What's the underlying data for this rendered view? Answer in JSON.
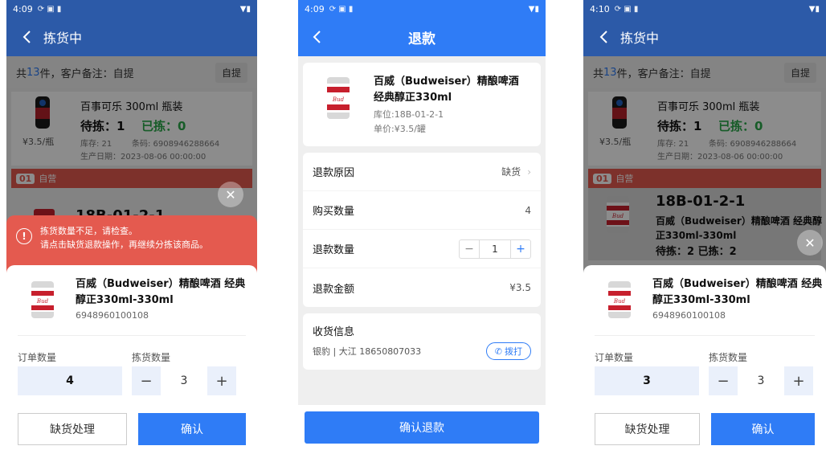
{
  "screens": {
    "picking_left": {
      "status": {
        "time": "4:09",
        "icons": "⟳ ▣ ▮",
        "right": "▼▮"
      },
      "title": "拣货中",
      "summary": {
        "prefix": "共",
        "count": "13",
        "mid": "件，客户备注：自提",
        "tag": "自提"
      },
      "product1": {
        "name": "百事可乐 300ml 瓶装",
        "wait": "待拣：1",
        "done": "已拣：0",
        "price": "¥3.5/瓶",
        "stock": "库存: 21",
        "barcode": "条码: 6908946288664",
        "date": "生产日期：2023-08-06 00:00:00"
      },
      "group": {
        "num": "01",
        "label": "自营"
      },
      "product2_partial": "18B-01-2-1",
      "alert": {
        "line1": "拣货数量不足，请检查。",
        "line2": "请点击缺货退款操作，再继续分拣该商品。"
      },
      "sheet": {
        "name": "百威（Budweiser）精酿啤酒 经典醇正330ml-330ml",
        "barcode": "6948960100108",
        "order_qty_label": "订单数量",
        "order_qty": "4",
        "pick_qty_label": "拣货数量",
        "pick_qty": "3"
      },
      "buttons": {
        "shortage": "缺货处理",
        "confirm": "确认"
      }
    },
    "refund": {
      "status": {
        "time": "4:09",
        "icons": "⟳ ▣ ▮",
        "right": "▼▮"
      },
      "title": "退款",
      "product": {
        "name": "百威（Budweiser）精酿啤酒 经典醇正330ml",
        "location": "库位:18B-01-2-1",
        "unit_price": "单价:¥3.5/罐"
      },
      "rows": {
        "reason_label": "退款原因",
        "reason_value": "缺货",
        "buy_label": "购买数量",
        "buy_value": "4",
        "refund_qty_label": "退款数量",
        "refund_qty": "1",
        "amount_label": "退款金额",
        "amount_value": "¥3.5"
      },
      "receive": {
        "label": "收货信息",
        "info": "银豹 | 大江 18650807033",
        "call": "拨打"
      },
      "confirm": "确认退款"
    },
    "picking_right": {
      "status": {
        "time": "4:10",
        "icons": "⟳ ▣ ▮",
        "right": "▼▮"
      },
      "title": "拣货中",
      "summary": {
        "prefix": "共",
        "count": "13",
        "mid": "件，客户备注：自提",
        "tag": "自提"
      },
      "product1": {
        "name": "百事可乐 300ml 瓶装",
        "wait": "待拣：1",
        "done": "已拣：0",
        "price": "¥3.5/瓶",
        "stock": "库存: 21",
        "barcode": "条码: 6908946288664",
        "date": "生产日期：2023-08-06 00:00:00"
      },
      "group": {
        "num": "01",
        "label": "自营"
      },
      "product2": {
        "location": "18B-01-2-1",
        "name": "百威（Budweiser）精酿啤酒 经典醇正330ml-330ml",
        "cut": "待拣：2    已拣：2"
      },
      "sheet": {
        "name": "百威（Budweiser）精酿啤酒 经典醇正330ml-330ml",
        "barcode": "6948960100108",
        "order_qty_label": "订单数量",
        "order_qty": "3",
        "pick_qty_label": "拣货数量",
        "pick_qty": "3"
      },
      "buttons": {
        "shortage": "缺货处理",
        "confirm": "确认"
      }
    }
  },
  "colors": {
    "appbar_dark": "#2c5aa8",
    "primary": "#2f7cf6",
    "alert": "#e45a4f",
    "green": "#2aa84a"
  }
}
